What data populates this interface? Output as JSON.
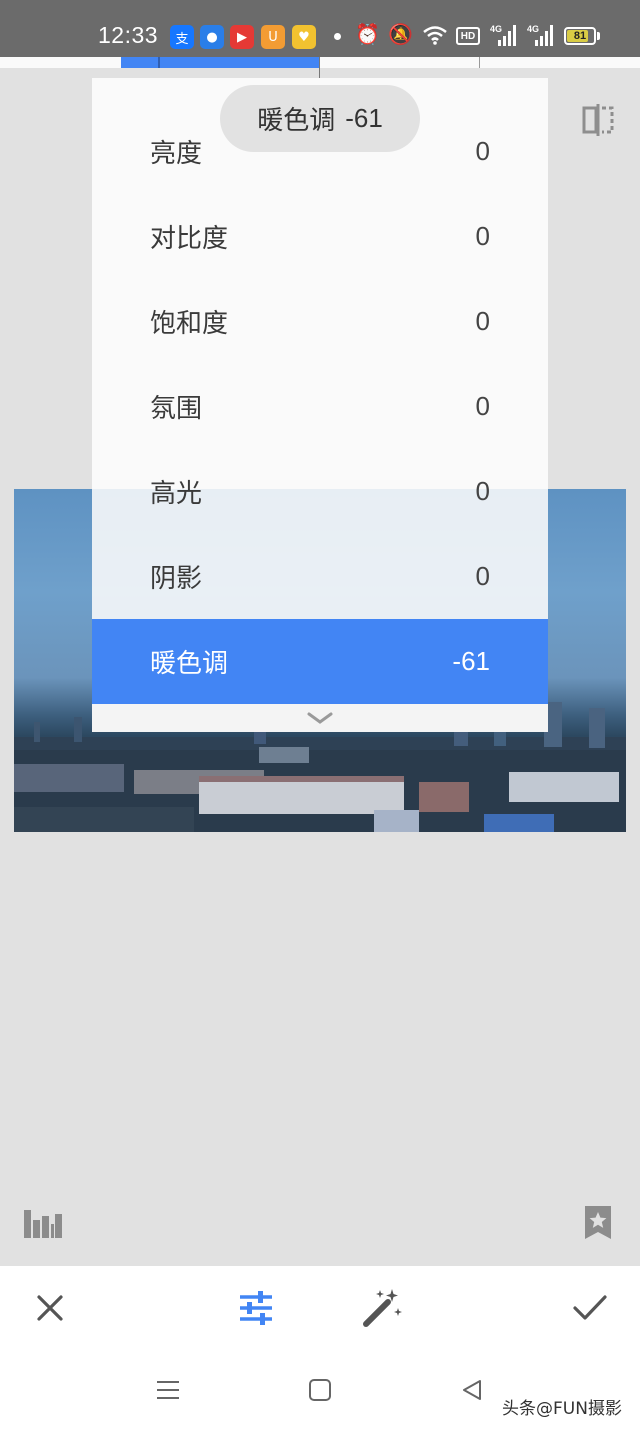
{
  "status_bar": {
    "time": "12:33",
    "battery": "81",
    "battery_level": 0.81,
    "hd_badge": "HD",
    "network_1": "4G",
    "network_2": "4G",
    "app_icons": [
      {
        "name": "alipay-icon",
        "glyph": "支",
        "color": "#1677ff"
      },
      {
        "name": "browser-icon",
        "glyph": "●",
        "color": "#2a7ee8"
      },
      {
        "name": "video-icon",
        "glyph": "▶",
        "color": "#e53935"
      },
      {
        "name": "uc-icon",
        "glyph": "U",
        "color": "#f39c33"
      },
      {
        "name": "heart-app-icon",
        "glyph": "♥",
        "color": "#f2c230"
      }
    ]
  },
  "tooltip": {
    "label": "暖色调",
    "value": "-61"
  },
  "adjust_menu": {
    "items": [
      {
        "label": "亮度",
        "value": "0"
      },
      {
        "label": "对比度",
        "value": "0"
      },
      {
        "label": "饱和度",
        "value": "0"
      },
      {
        "label": "氛围",
        "value": "0"
      },
      {
        "label": "高光",
        "value": "0"
      },
      {
        "label": "阴影",
        "value": "0"
      },
      {
        "label": "暖色调",
        "value": "-61",
        "selected": true
      }
    ]
  },
  "colors": {
    "accent": "#4285f4",
    "background": "#e1e1e1",
    "status_bar": "#6b6b6b"
  },
  "toolbar": {
    "cancel": "close-icon",
    "adjust": "sliders-icon",
    "auto": "magic-wand-icon",
    "apply": "check-icon"
  },
  "watermark": "头条@FUN摄影"
}
